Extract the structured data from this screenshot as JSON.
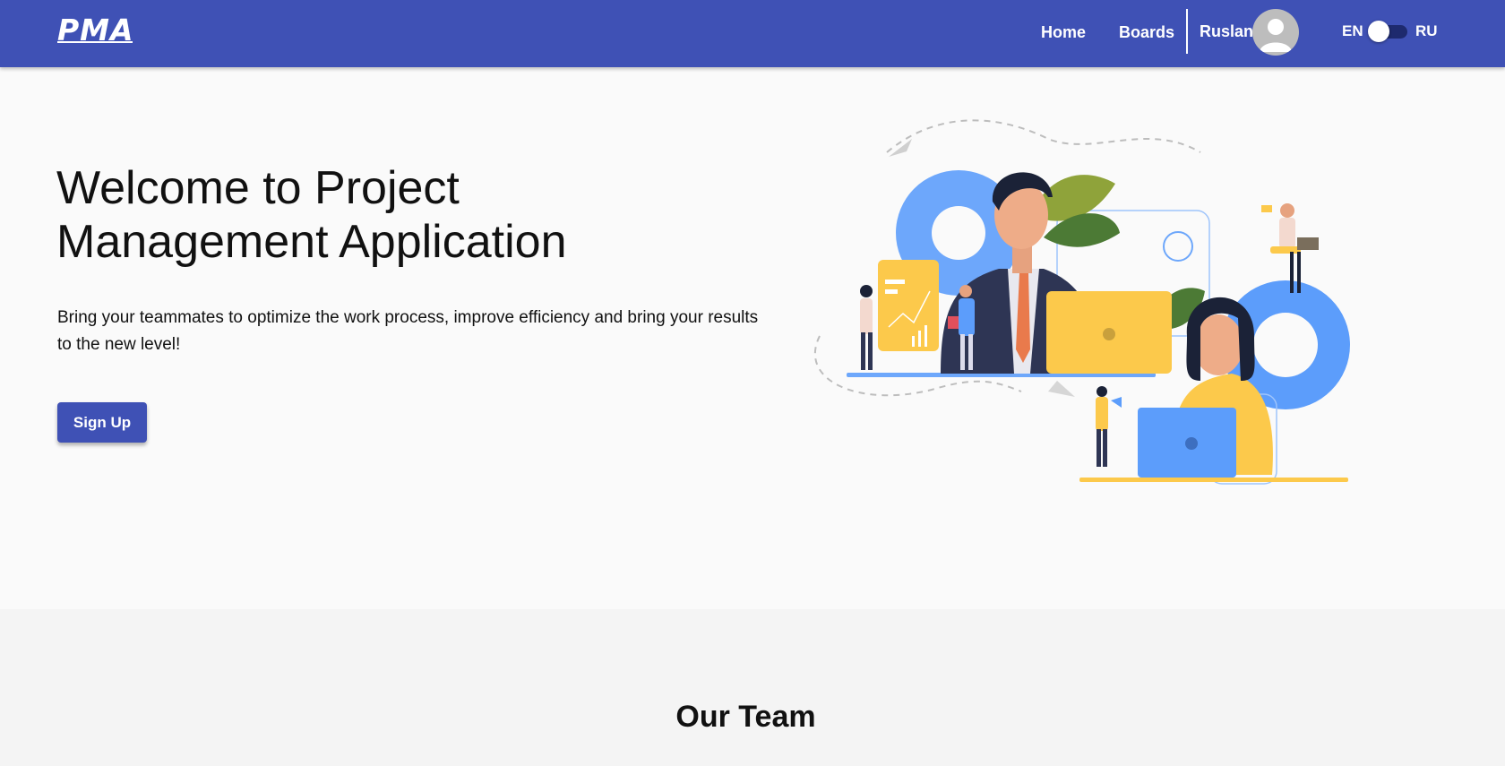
{
  "header": {
    "logo": "PMA",
    "nav": {
      "home": "Home",
      "boards": "Boards"
    },
    "user": {
      "name": "Ruslan"
    },
    "language": {
      "left": "EN",
      "right": "RU"
    }
  },
  "hero": {
    "title": "Welcome to Project Management Application",
    "description": "Bring your teammates to optimize the work process, improve efficiency and bring your results to the new level!",
    "signup_label": "Sign Up"
  },
  "team": {
    "title": "Our Team"
  },
  "colors": {
    "primary": "#3f51b5",
    "background": "#fafafa",
    "section_background": "#f4f4f4",
    "illustration_blue": "#5c9dfb",
    "illustration_yellow": "#fcc94b",
    "illustration_navy": "#2e3554"
  },
  "icons": [
    "user-avatar-icon",
    "language-toggle"
  ]
}
